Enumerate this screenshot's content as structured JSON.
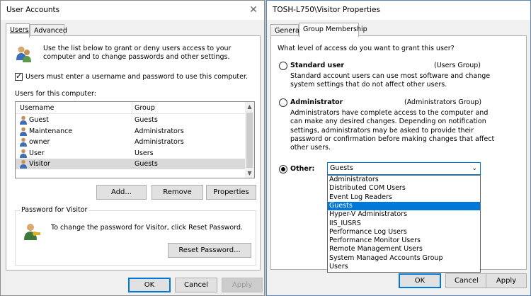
{
  "user_accounts": {
    "title": "User Accounts",
    "close": "✕",
    "tabs": [
      {
        "label": "Users",
        "active": true
      },
      {
        "label": "Advanced",
        "active": false
      }
    ],
    "description": "Use the list below to grant or deny users access to your computer and to change passwords and other settings.",
    "require_login": {
      "label": "Users must enter a username and password to use this computer.",
      "checked": true
    },
    "users_label": "Users for this computer:",
    "columns": [
      "Username",
      "Group"
    ],
    "users": [
      {
        "name": "Guest",
        "group": "Guests"
      },
      {
        "name": "Maintenance",
        "group": "Administrators"
      },
      {
        "name": "owner",
        "group": "Administrators"
      },
      {
        "name": "User",
        "group": "Users"
      },
      {
        "name": "Visitor",
        "group": "Guests",
        "selected": true
      }
    ],
    "buttons": {
      "add": "Add...",
      "remove": "Remove",
      "properties": "Properties"
    },
    "password_group": {
      "title": "Password for Visitor",
      "text": "To change the password for Visitor, click Reset Password.",
      "reset_button": "Reset Password..."
    },
    "footer": {
      "ok": "OK",
      "cancel": "Cancel",
      "apply": "Apply"
    }
  },
  "properties": {
    "title": "TOSH-L750\\Visitor Properties",
    "tabs": [
      {
        "label": "General",
        "active": false
      },
      {
        "label": "Group Membership",
        "active": true
      }
    ],
    "question": "What level of access do you want to grant this user?",
    "options": {
      "standard": {
        "label": "Standard user",
        "group": "(Users Group)",
        "desc": [
          "Standard account users can use most software and change",
          "system settings that do not affect other users."
        ],
        "checked": false
      },
      "administrator": {
        "label": "Administrator",
        "group": "(Administrators Group)",
        "desc": [
          "Administrators have complete access to the computer and",
          "can make any desired changes. Depending on notification",
          "settings, administrators may be asked to provide their",
          "password or confirmation before making changes that affect",
          "other users."
        ],
        "checked": false
      },
      "other": {
        "label": "Other:",
        "checked": true
      }
    },
    "combo_value": "Guests",
    "dropdown_items": [
      "Administrators",
      "Distributed COM Users",
      "Event Log Readers",
      "Guests",
      "Hyper-V Administrators",
      "IIS_IUSRS",
      "Performance Log Users",
      "Performance Monitor Users",
      "Remote Management Users",
      "System Managed Accounts Group",
      "Users"
    ],
    "dropdown_selected": "Guests",
    "footer": {
      "ok": "OK",
      "cancel": "Cancel",
      "apply": "Apply"
    }
  }
}
